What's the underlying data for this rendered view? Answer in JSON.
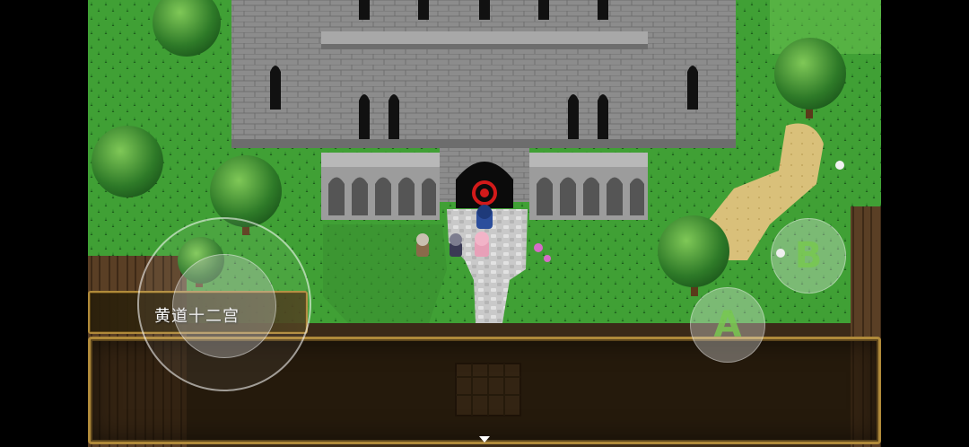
{
  "game": {
    "map_name": "黄道十二宫",
    "controls": {
      "a_button": "A",
      "b_button": "B"
    }
  },
  "colors": {
    "grass": "#3f9a36",
    "stone": "#8f8f8f",
    "frame_gold": "#b08a3a",
    "button_letter": "#78c850"
  }
}
